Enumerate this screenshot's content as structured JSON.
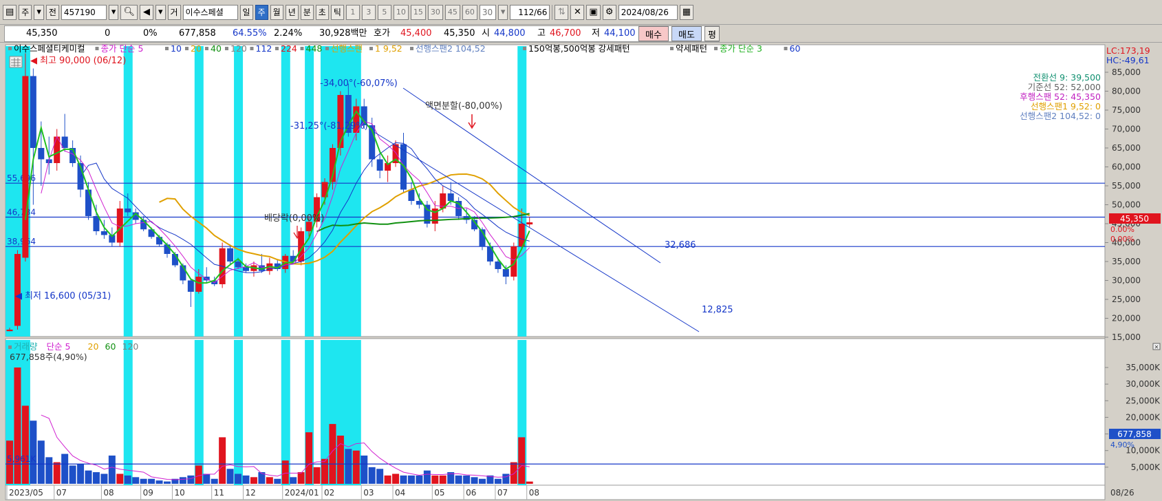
{
  "toolbar": {
    "market": "주",
    "period_select": "전",
    "code": "457190",
    "type_badge": "거",
    "stock_name": "이수스페셜",
    "periods": [
      "일",
      "주",
      "월",
      "년",
      "분",
      "초",
      "틱"
    ],
    "selected_period": "주",
    "intervals": [
      "1",
      "3",
      "5",
      "10",
      "15",
      "30",
      "45",
      "60"
    ],
    "interval_value": "30",
    "count_display": "112/66",
    "date": "2024/08/26"
  },
  "quote": {
    "price": "45,350",
    "change": "0",
    "change_pct": "0%",
    "volume": "677,858",
    "vol_ratio": "64.55%",
    "turnover": "2.24%",
    "amount": "30,928백만",
    "ask_label": "호가",
    "ask": "45,400",
    "bid": "45,350",
    "open_label": "시",
    "open": "44,800",
    "high_label": "고",
    "high": "46,700",
    "low_label": "저",
    "low": "44,100",
    "buy": "매수",
    "sell": "매도",
    "avg": "평"
  },
  "price_panel": {
    "legend": [
      {
        "text": "이수스페셜티케미컬",
        "color": "#000000"
      },
      {
        "text": "종가 단순 5",
        "color": "#d020d0"
      },
      {
        "text": "10",
        "color": "#1436c8"
      },
      {
        "text": "20",
        "color": "#e0a000"
      },
      {
        "text": "40",
        "color": "#109010"
      },
      {
        "text": "120",
        "color": "#808080"
      },
      {
        "text": "112",
        "color": "#1436c8"
      },
      {
        "text": "224",
        "color": "#e0141e"
      },
      {
        "text": "448",
        "color": "#109010"
      },
      {
        "text": "선행스팬",
        "color": "#e0a000"
      },
      {
        "text": "1 9,52",
        "color": "#e0a000"
      },
      {
        "text": "선행스팬2 104,52",
        "color": "#6080c0"
      },
      {
        "text": "150억봉,500억봉 강세패턴",
        "color": "#000000"
      },
      {
        "text": "약세패턴",
        "color": "#000000"
      },
      {
        "text": "종가 단순 3",
        "color": "#20b020"
      },
      {
        "text": "60",
        "color": "#1436c8"
      }
    ],
    "lc": "LC:173,19",
    "hc": "HC:-49,61",
    "ichimoku": [
      {
        "text": "전환선 9: 39,500",
        "color": "#109070"
      },
      {
        "text": "기준선 52: 52,000",
        "color": "#606060"
      },
      {
        "text": "후행스팬 52: 45,350",
        "color": "#c020c0"
      },
      {
        "text": "선행스팬1 9,52: 0",
        "color": "#e0a000"
      },
      {
        "text": "선행스팬2 104,52: 0",
        "color": "#6080c0"
      }
    ],
    "y_ticks": [
      "85,000",
      "80,000",
      "75,000",
      "70,000",
      "65,000",
      "60,000",
      "55,000",
      "50,000",
      "45,000",
      "40,000",
      "35,000",
      "30,000",
      "25,000",
      "20,000",
      "15,000"
    ],
    "current_price": "45,350",
    "current_change": "0.00%",
    "current_change2": "0.00%",
    "hlines": [
      "55,696",
      "46,734",
      "38,964"
    ],
    "annotations": {
      "high": "최고 90,000 (06/12)",
      "low": "최저 16,600 (05/31)",
      "slope1": "-34,00°(-60,07%)",
      "slope2": "-31,25°(-81,29%)",
      "split": "액면분할(-80,00%)",
      "dividend": "배당락(0,00%)",
      "target1": "32,686",
      "target2": "12,825"
    }
  },
  "volume_panel": {
    "legend": [
      {
        "text": "거래량",
        "color": "#20b0b0"
      },
      {
        "text": "단순 5",
        "color": "#d020d0"
      },
      {
        "text": "20",
        "color": "#e0a000"
      },
      {
        "text": "60",
        "color": "#109010"
      },
      {
        "text": "120",
        "color": "#808080"
      }
    ],
    "info": "677,858주(4,90%)",
    "hline_label": "5,961K",
    "y_ticks": [
      "35,000K",
      "30,000K",
      "25,000K",
      "20,000K",
      "15,000K",
      "10,000K",
      "5,000K"
    ],
    "current_volume": "677,858",
    "current_pct": "4,90%"
  },
  "x_axis": {
    "labels": [
      "2023/05",
      "07",
      "08",
      "09",
      "10",
      "11",
      "12",
      "2024/01",
      "02",
      "03",
      "04",
      "05",
      "06",
      "07",
      "08"
    ],
    "right_label": "08/26"
  },
  "colors": {
    "up": "#e0141e",
    "down": "#1e50c8",
    "highlight": "#1ee6f0",
    "ma5": "#d020d0",
    "ma3": "#20c020",
    "ma10": "#1436c8",
    "ma20": "#e0a000",
    "ma40": "#109010"
  }
}
